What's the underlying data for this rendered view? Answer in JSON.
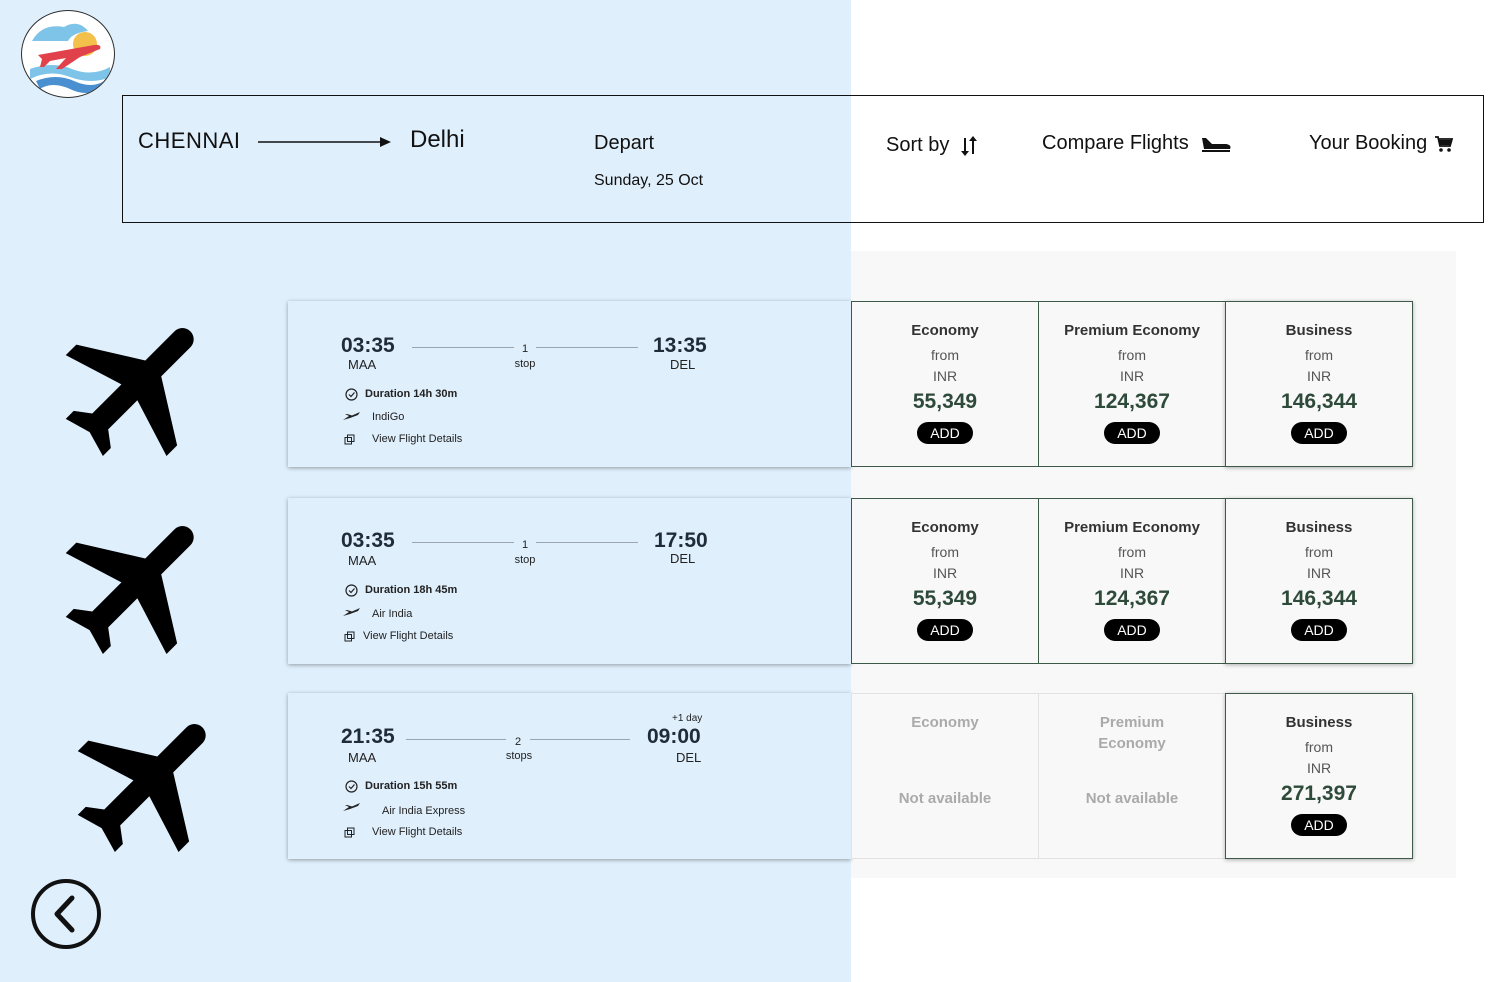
{
  "header": {
    "from_city": "CHENNAI",
    "to_city": "Delhi",
    "depart_label": "Depart",
    "depart_date": "Sunday, 25 Oct",
    "sort_label": "Sort by",
    "compare_label": "Compare Flights",
    "booking_label": "Your Booking"
  },
  "flights": [
    {
      "dep_time": "03:35",
      "dep_code": "MAA",
      "stops_n": "1",
      "stops_word": "stop",
      "arr_time": "13:35",
      "arr_code": "DEL",
      "plus_day": "",
      "duration": "Duration 14h 30m",
      "airline": "IndiGo",
      "details_link": "View Flight Details",
      "fares": {
        "economy": {
          "name": "Economy",
          "from": "from",
          "currency": "INR",
          "price": "55,349",
          "add": "ADD"
        },
        "premium": {
          "name": "Premium Economy",
          "from": "from",
          "currency": "INR",
          "price": "124,367",
          "add": "ADD"
        },
        "business": {
          "name": "Business",
          "from": "from",
          "currency": "INR",
          "price": "146,344",
          "add": "ADD"
        }
      }
    },
    {
      "dep_time": "03:35",
      "dep_code": "MAA",
      "stops_n": "1",
      "stops_word": "stop",
      "arr_time": "17:50",
      "arr_code": "DEL",
      "plus_day": "",
      "duration": "Duration 18h 45m",
      "airline": "Air India",
      "details_link": "View Flight Details",
      "fares": {
        "economy": {
          "name": "Economy",
          "from": "from",
          "currency": "INR",
          "price": "55,349",
          "add": "ADD"
        },
        "premium": {
          "name": "Premium Economy",
          "from": "from",
          "currency": "INR",
          "price": "124,367",
          "add": "ADD"
        },
        "business": {
          "name": "Business",
          "from": "from",
          "currency": "INR",
          "price": "146,344",
          "add": "ADD"
        }
      }
    },
    {
      "dep_time": "21:35",
      "dep_code": "MAA",
      "stops_n": "2",
      "stops_word": "stops",
      "arr_time": "09:00",
      "arr_code": "DEL",
      "plus_day": "+1 day",
      "duration": "Duration 15h 55m",
      "airline": "Air India Express",
      "details_link": "View Flight Details",
      "fares": {
        "economy": {
          "name": "Economy",
          "na": "Not available"
        },
        "premium": {
          "name": "Premium Economy",
          "na": "Not available"
        },
        "business": {
          "name": "Business",
          "from": "from",
          "currency": "INR",
          "price": "271,397",
          "add": "ADD"
        }
      }
    }
  ],
  "colors": {
    "left_bg": "#dfeffc",
    "price_green": "#2e4a3a",
    "add_button": "#000000"
  },
  "icons": {
    "logo": "airline-logo-icon",
    "back": "back-arrow-icon",
    "sort": "sort-arrows-icon",
    "compare": "airplane-landing-icon",
    "booking": "cart-icon",
    "flight": "airplane-icon"
  }
}
